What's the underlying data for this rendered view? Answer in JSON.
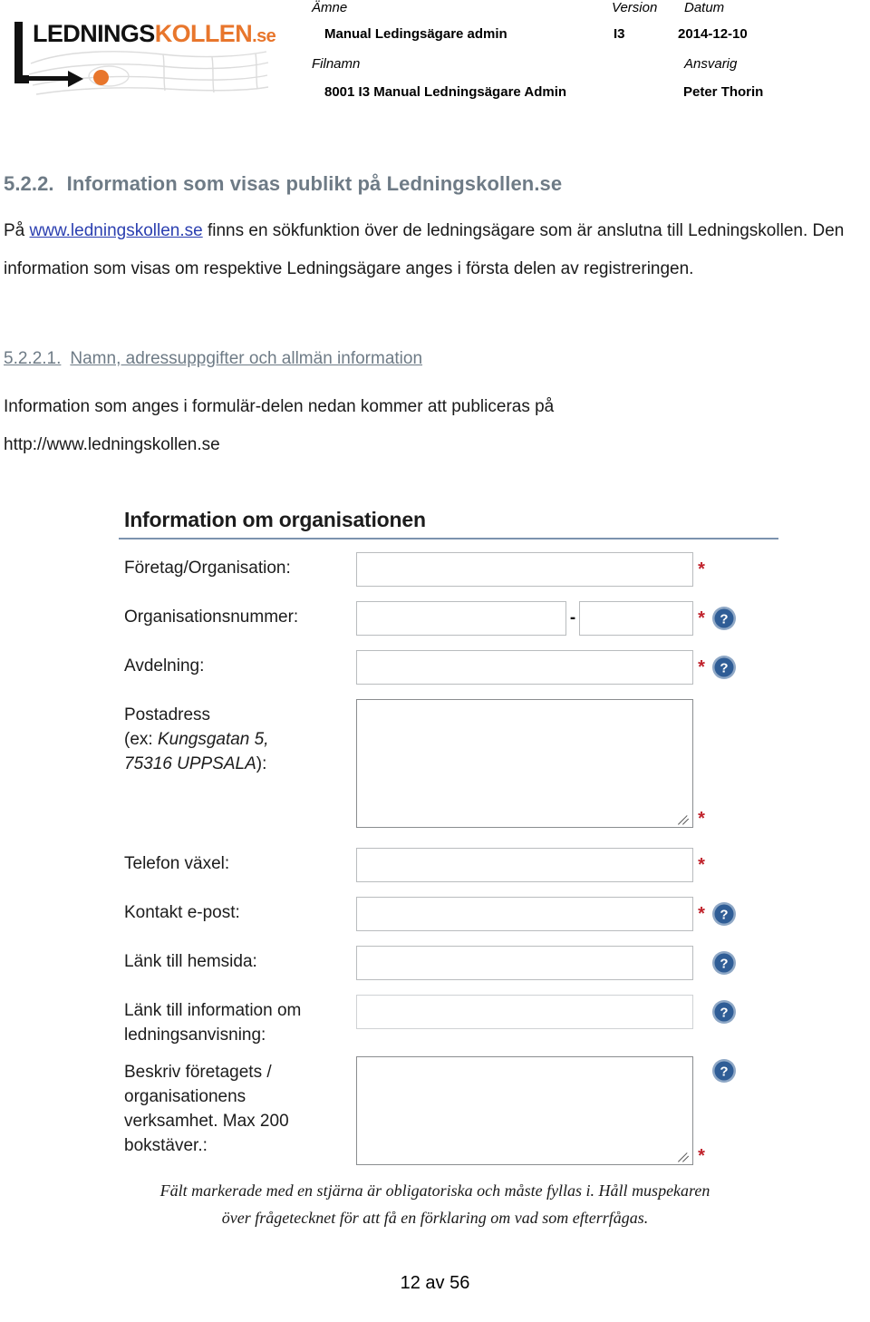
{
  "header": {
    "logo": {
      "word_black": "LEDNINGS",
      "word_orange": "KOLLEN",
      "suffix": ".se"
    },
    "labels": {
      "amne": "Ämne",
      "version": "Version",
      "datum": "Datum",
      "filnamn": "Filnamn",
      "ansvarig": "Ansvarig"
    },
    "values": {
      "amne": "Manual Ledingsägare admin",
      "version": "I3",
      "datum": "2014-12-10",
      "filnamn": "8001 I3 Manual Ledningsägare Admin",
      "ansvarig": "Peter Thorin"
    }
  },
  "section": {
    "number": "5.2.2.",
    "title": "Information som visas publikt på Ledningskollen.se",
    "para_1_before_link": "På ",
    "para_1_link": "www.ledningskollen.se",
    "para_1_after_link": " finns en sökfunktion över de ledningsägare som är anslutna till Ledningskollen. Den information som visas om respektive Ledningsägare anges i första delen av registreringen."
  },
  "subsection": {
    "number": "5.2.2.1.",
    "title": "Namn, adressuppgifter och allmän information",
    "para": "Information som anges i formulär-delen nedan kommer att publiceras på http://www.ledningskollen.se"
  },
  "form": {
    "title": "Information om organisationen",
    "rows": [
      {
        "label": "Företag/Organisation:",
        "type": "text",
        "required": true,
        "help": false
      },
      {
        "label": "Organisationsnummer:",
        "type": "split-text",
        "separator": "-",
        "required": true,
        "help": true
      },
      {
        "label": "Avdelning:",
        "type": "text",
        "required": true,
        "help": true
      },
      {
        "label_line1": "Postadress",
        "label_line2_prefix": "(ex: ",
        "label_line2_italic": "Kungsgatan 5,",
        "label_line3_italic": "75316 UPPSALA",
        "label_line3_suffix": "):",
        "type": "textarea-large",
        "required": true,
        "help": false
      },
      {
        "label": "Telefon växel:",
        "type": "text",
        "required": true,
        "help": false
      },
      {
        "label": "Kontakt e-post:",
        "type": "text",
        "required": true,
        "help": true
      },
      {
        "label": "Länk till hemsida:",
        "type": "text",
        "required": false,
        "help": true
      },
      {
        "label_line1": "Länk till information om",
        "label_line2": "ledningsanvisning:",
        "type": "text",
        "required": false,
        "help": true
      },
      {
        "label_line1": "Beskriv företagets /",
        "label_line2": "organisationens",
        "label_line3": "verksamhet. Max 200",
        "label_line4": "bokstäver.:",
        "type": "textarea",
        "required": true,
        "help": true
      }
    ],
    "footnote_line1": "Fält markerade med en stjärna är obligatoriska och måste fyllas i. Håll muspekaren",
    "footnote_line2": "över frågetecknet för att få en förklaring om vad som efterrfågas.",
    "required_marker": "*"
  },
  "footer": {
    "page": "12 av 56"
  },
  "colors": {
    "brand_orange": "#E8762C",
    "heading_gray": "#6E7B86",
    "link_blue": "#2B3FB0",
    "required_red": "#C0222B",
    "rule_blue": "#7C93AE",
    "help_blue": "#2F5D96"
  }
}
